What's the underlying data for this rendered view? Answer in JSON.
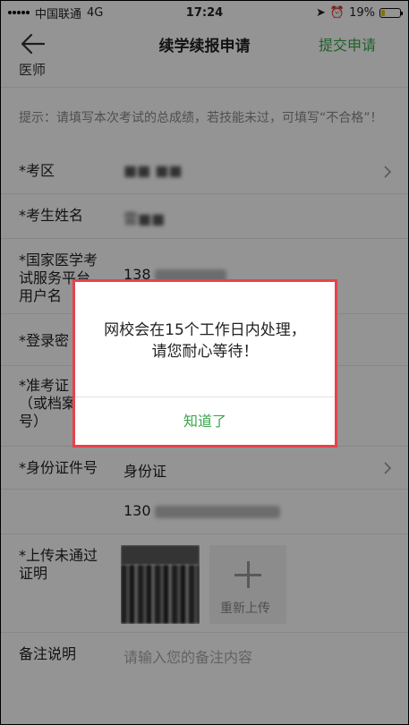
{
  "status_bar": {
    "carrier": "中国联通",
    "network": "4G",
    "time": "17:24",
    "battery": "19%",
    "battery_level": 0.19
  },
  "nav": {
    "title": "续学续报申请",
    "submit": "提交申请"
  },
  "form": {
    "partial_label": "医师",
    "hint": "提示：请填写本次考试的总成绩，若技能未过，可填写“不合格”！",
    "exam_area": {
      "label": "*考区",
      "value": "■■ ■■"
    },
    "name": {
      "label": "*考生姓名",
      "value": "雷■■"
    },
    "platform_user": {
      "label_lines": [
        "*国家医学考",
        "试服务平台",
        "用户名"
      ],
      "value": "138"
    },
    "password": {
      "label": "*登录密"
    },
    "ticket": {
      "label_lines": [
        "*准考证",
        "（或档案",
        "号）"
      ]
    },
    "id_type": {
      "label": "*身份证件号",
      "value": "身份证"
    },
    "id_number": {
      "value": "130"
    },
    "upload": {
      "label_lines": [
        "*上传未通过",
        "证明"
      ],
      "reupload": "重新上传"
    },
    "remark": {
      "label": "备注说明",
      "placeholder": "请输入您的备注内容"
    }
  },
  "dialog": {
    "line1": "网校会在15个工作日内处理，",
    "line2": "请您耐心等待！",
    "button": "知道了"
  },
  "colors": {
    "accent_green": "#3aa64a",
    "highlight_red": "#e8424a"
  }
}
